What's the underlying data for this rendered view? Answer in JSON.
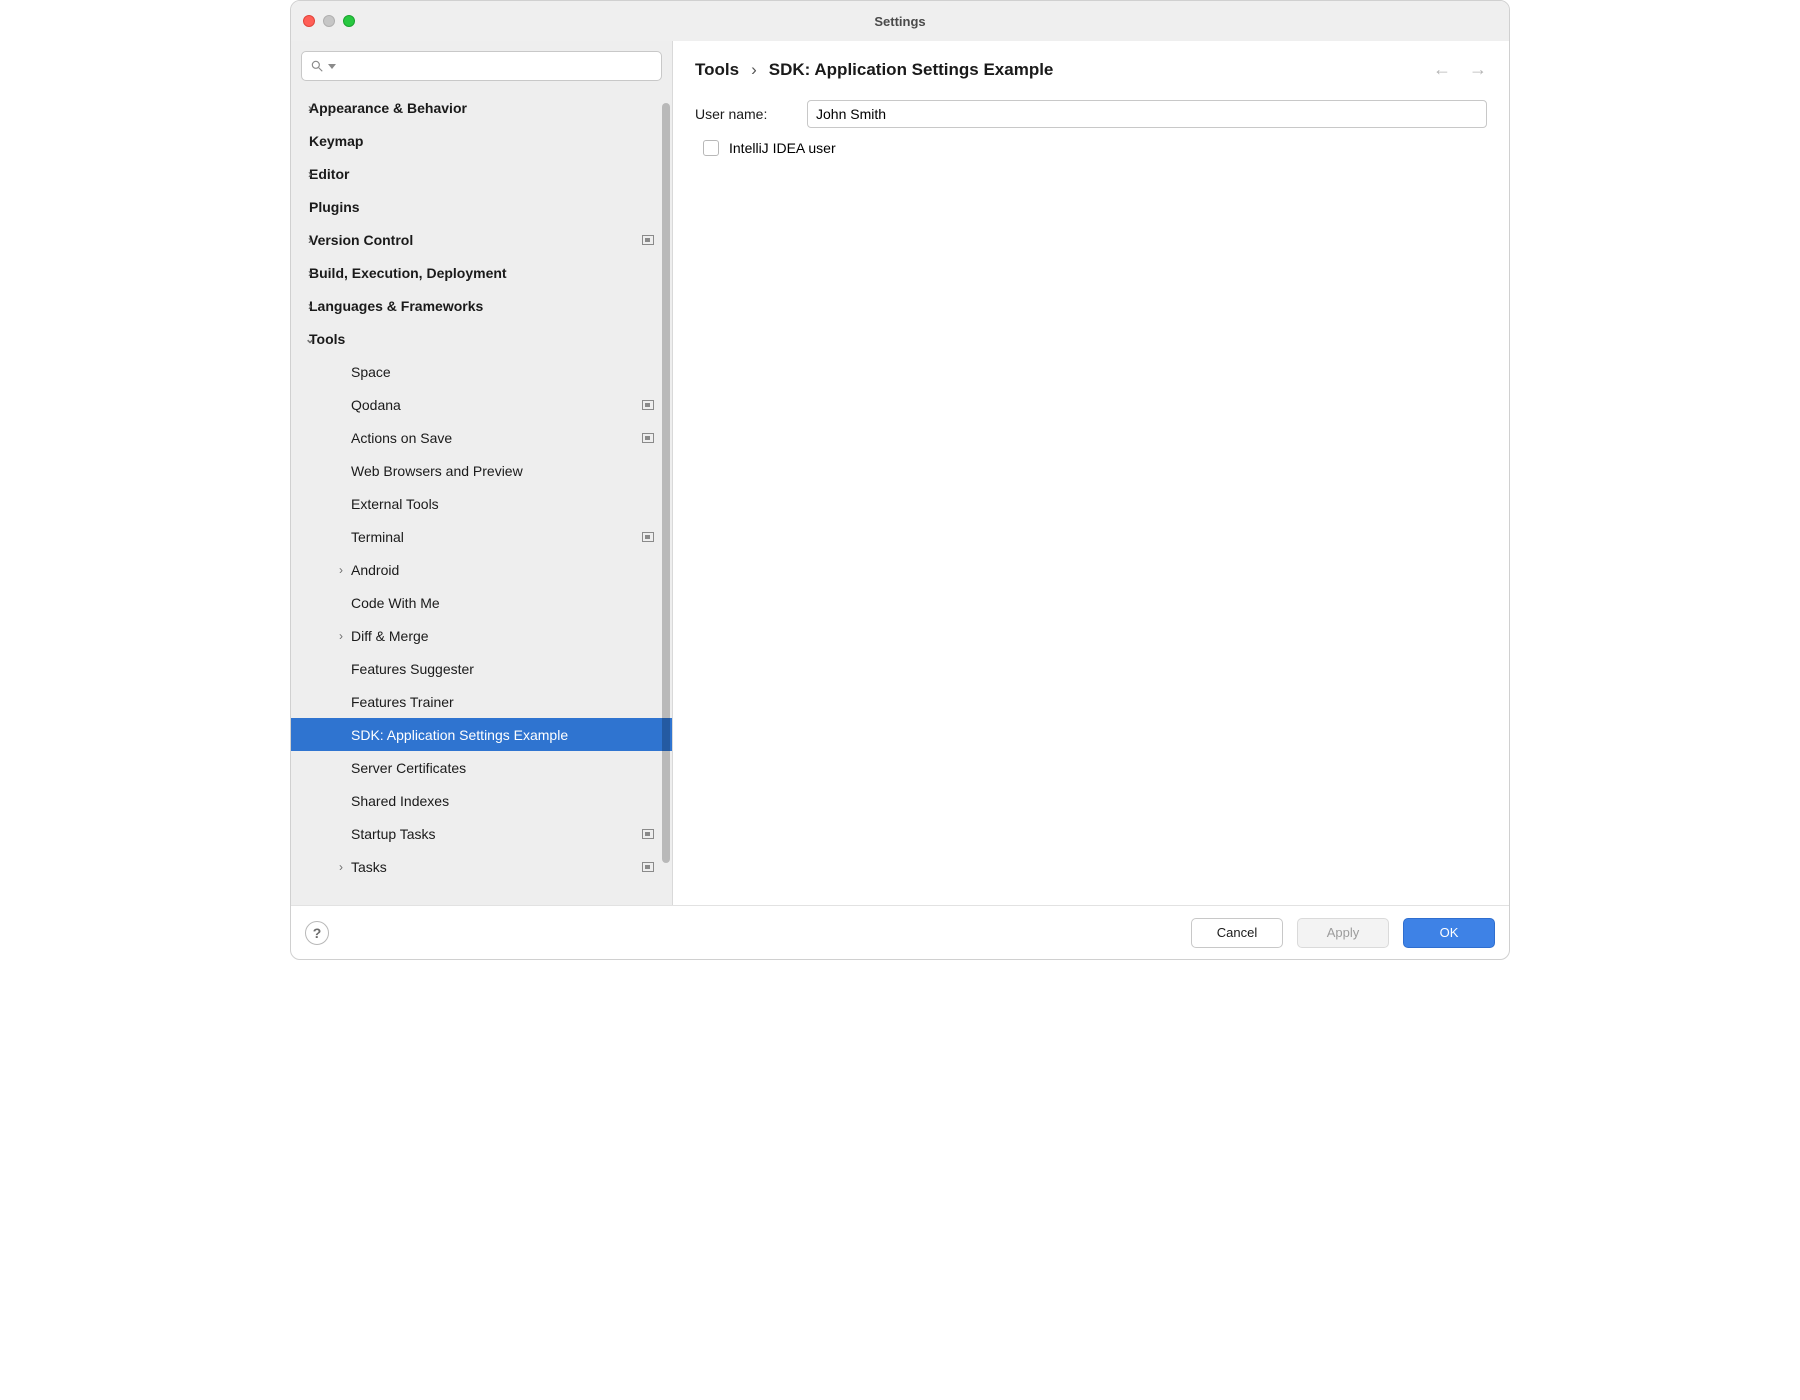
{
  "window": {
    "title": "Settings"
  },
  "search": {
    "placeholder": ""
  },
  "sidebar": {
    "items": [
      {
        "label": "Appearance & Behavior",
        "level": 0,
        "chevron": "right",
        "badge": false
      },
      {
        "label": "Keymap",
        "level": 0,
        "chevron": "",
        "badge": false
      },
      {
        "label": "Editor",
        "level": 0,
        "chevron": "right",
        "badge": false
      },
      {
        "label": "Plugins",
        "level": 0,
        "chevron": "",
        "badge": false
      },
      {
        "label": "Version Control",
        "level": 0,
        "chevron": "right",
        "badge": true
      },
      {
        "label": "Build, Execution, Deployment",
        "level": 0,
        "chevron": "right",
        "badge": false
      },
      {
        "label": "Languages & Frameworks",
        "level": 0,
        "chevron": "right",
        "badge": false
      },
      {
        "label": "Tools",
        "level": 0,
        "chevron": "down",
        "badge": false
      },
      {
        "label": "Space",
        "level": 1,
        "chevron": "",
        "badge": false
      },
      {
        "label": "Qodana",
        "level": 1,
        "chevron": "",
        "badge": true
      },
      {
        "label": "Actions on Save",
        "level": 1,
        "chevron": "",
        "badge": true
      },
      {
        "label": "Web Browsers and Preview",
        "level": 1,
        "chevron": "",
        "badge": false
      },
      {
        "label": "External Tools",
        "level": 1,
        "chevron": "",
        "badge": false
      },
      {
        "label": "Terminal",
        "level": 1,
        "chevron": "",
        "badge": true
      },
      {
        "label": "Android",
        "level": 1,
        "chevron": "right",
        "badge": false
      },
      {
        "label": "Code With Me",
        "level": 1,
        "chevron": "",
        "badge": false
      },
      {
        "label": "Diff & Merge",
        "level": 1,
        "chevron": "right",
        "badge": false
      },
      {
        "label": "Features Suggester",
        "level": 1,
        "chevron": "",
        "badge": false
      },
      {
        "label": "Features Trainer",
        "level": 1,
        "chevron": "",
        "badge": false
      },
      {
        "label": "SDK: Application Settings Example",
        "level": 1,
        "chevron": "",
        "badge": false,
        "selected": true
      },
      {
        "label": "Server Certificates",
        "level": 1,
        "chevron": "",
        "badge": false
      },
      {
        "label": "Shared Indexes",
        "level": 1,
        "chevron": "",
        "badge": false
      },
      {
        "label": "Startup Tasks",
        "level": 1,
        "chevron": "",
        "badge": true
      },
      {
        "label": "Tasks",
        "level": 1,
        "chevron": "right",
        "badge": true
      }
    ]
  },
  "breadcrumb": {
    "parent": "Tools",
    "current": "SDK: Application Settings Example"
  },
  "form": {
    "username_label": "User name:",
    "username_value": "John Smith",
    "checkbox_label": "IntelliJ IDEA user",
    "checkbox_checked": false
  },
  "footer": {
    "help": "?",
    "cancel": "Cancel",
    "apply": "Apply",
    "ok": "OK"
  }
}
